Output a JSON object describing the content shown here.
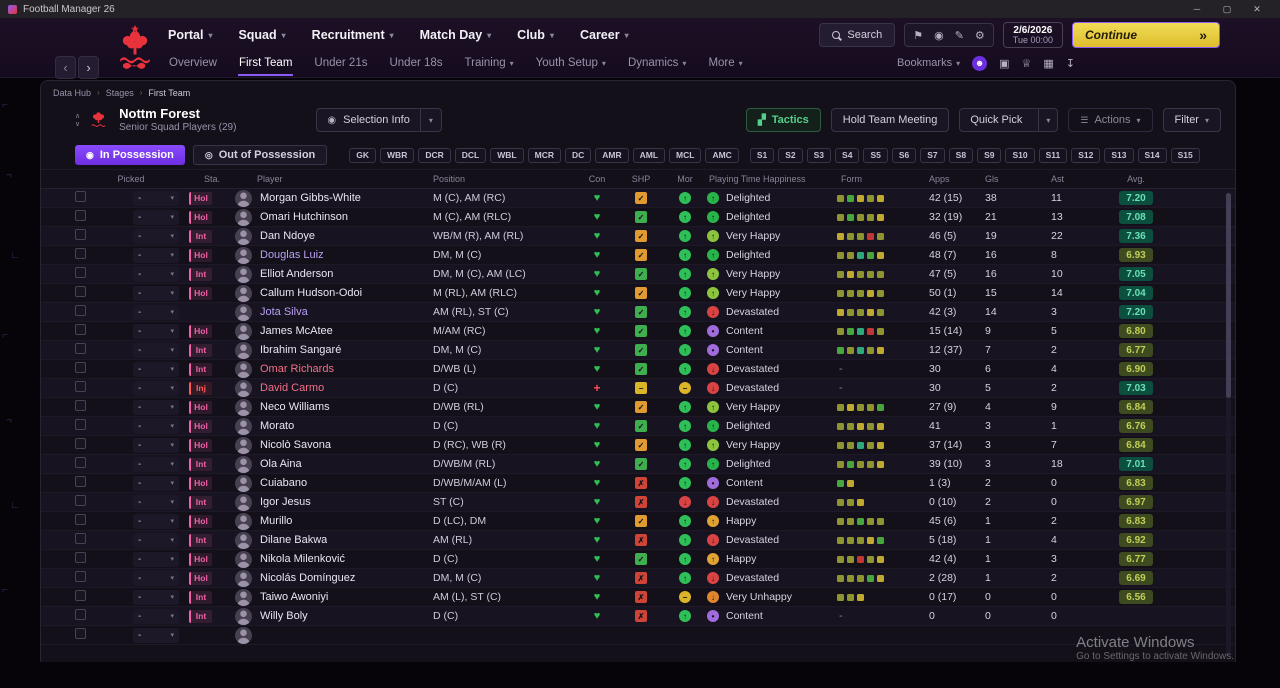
{
  "titlebar": {
    "title": "Football Manager 26",
    "controls": [
      {
        "name": "minimize-button",
        "glyph": "─"
      },
      {
        "name": "maximize-button",
        "glyph": "▢"
      },
      {
        "name": "close-button",
        "glyph": "✕"
      }
    ]
  },
  "nav": {
    "menus": [
      {
        "label": "Portal"
      },
      {
        "label": "Squad"
      },
      {
        "label": "Recruitment"
      },
      {
        "label": "Match Day"
      },
      {
        "label": "Club"
      },
      {
        "label": "Career"
      }
    ],
    "search_label": "Search",
    "icons": [
      {
        "name": "bookmark-icon",
        "glyph": "⚑"
      },
      {
        "name": "ball-icon",
        "glyph": "◉"
      },
      {
        "name": "edit-icon",
        "glyph": "✎"
      },
      {
        "name": "settings-icon",
        "glyph": "⚙"
      }
    ],
    "date": "2/6/2026",
    "time": "Tue 00:00",
    "continue_label": "Continue",
    "continue_chevron": "»"
  },
  "subnav": {
    "tabs": [
      {
        "label": "Overview",
        "caret": false
      },
      {
        "label": "First Team",
        "caret": false
      },
      {
        "label": "Under 21s",
        "caret": false
      },
      {
        "label": "Under 18s",
        "caret": false
      },
      {
        "label": "Training",
        "caret": true
      },
      {
        "label": "Youth Setup",
        "caret": true
      },
      {
        "label": "Dynamics",
        "caret": true
      },
      {
        "label": "More",
        "caret": true
      }
    ],
    "active": "First Team",
    "bookmarks_label": "Bookmarks",
    "icons": [
      {
        "name": "assistant-icon",
        "glyph": "☻",
        "accent": true
      },
      {
        "name": "squad-icon",
        "glyph": "▣",
        "accent": false
      },
      {
        "name": "awards-icon",
        "glyph": "♕",
        "accent": false
      },
      {
        "name": "calendar-icon",
        "glyph": "▦",
        "accent": false
      },
      {
        "name": "export-icon",
        "glyph": "↧",
        "accent": false
      }
    ]
  },
  "breadcrumb": [
    "Data Hub",
    "Stages",
    "First Team"
  ],
  "header": {
    "team": "Nottm Forest",
    "subtitle": "Senior Squad Players (29)",
    "selection_info": "Selection Info",
    "buttons": {
      "tactics": "Tactics",
      "meeting": "Hold Team Meeting",
      "quick_pick": "Quick Pick",
      "actions": "Actions",
      "filter": "Filter"
    }
  },
  "possession": {
    "in": "In Possession",
    "out": "Out of Possession"
  },
  "position_chips": [
    "GK",
    "WBR",
    "DCR",
    "DCL",
    "WBL",
    "MCR",
    "DC",
    "AMR",
    "AML",
    "MCL",
    "AMC",
    "S1",
    "S2",
    "S3",
    "S4",
    "S5",
    "S6",
    "S7",
    "S8",
    "S9",
    "S10",
    "S11",
    "S12",
    "S13",
    "S14",
    "S15"
  ],
  "table": {
    "columns": [
      "Picked",
      "Sta.",
      "Player",
      "Position",
      "Con",
      "SHP",
      "Mor",
      "Playing Time Happiness",
      "Form",
      "Apps",
      "Gls",
      "Ast",
      "Avg."
    ],
    "picked_value": "-",
    "rows": [
      {
        "status": "Hol",
        "name": "Morgan Gibbs-White",
        "name_color": "default",
        "position": "M (C), AM (RC)",
        "con": "green",
        "shp": "orange",
        "mor": "green",
        "happy": "Delighted",
        "form": [
          "olive",
          "green",
          "yellow",
          "olive",
          "yellow"
        ],
        "apps": "42 (15)",
        "gls": "38",
        "ast": "11",
        "avg": "7.20"
      },
      {
        "status": "Hol",
        "name": "Omari Hutchinson",
        "name_color": "default",
        "position": "M (C), AM (RLC)",
        "con": "green",
        "shp": "green",
        "mor": "green",
        "happy": "Delighted",
        "form": [
          "olive",
          "green",
          "olive",
          "olive",
          "yellow"
        ],
        "apps": "32 (19)",
        "gls": "21",
        "ast": "13",
        "avg": "7.08"
      },
      {
        "status": "Int",
        "name": "Dan Ndoye",
        "name_color": "default",
        "position": "WB/M (R), AM (RL)",
        "con": "green",
        "shp": "orange",
        "mor": "green",
        "happy": "Very Happy",
        "form": [
          "yellow",
          "olive",
          "olive",
          "red",
          "olive"
        ],
        "apps": "46 (5)",
        "gls": "19",
        "ast": "22",
        "avg": "7.36"
      },
      {
        "status": "Hol",
        "name": "Douglas Luiz",
        "name_color": "purple",
        "position": "DM, M (C)",
        "con": "green",
        "shp": "orange",
        "mor": "green",
        "happy": "Delighted",
        "form": [
          "olive",
          "olive",
          "teal",
          "green",
          "yellow"
        ],
        "apps": "48 (7)",
        "gls": "16",
        "ast": "8",
        "avg": "6.93"
      },
      {
        "status": "Int",
        "name": "Elliot Anderson",
        "name_color": "default",
        "position": "DM, M (C), AM (LC)",
        "con": "green",
        "shp": "green",
        "mor": "green",
        "happy": "Very Happy",
        "form": [
          "olive",
          "yellow",
          "olive",
          "olive",
          "olive"
        ],
        "apps": "47 (5)",
        "gls": "16",
        "ast": "10",
        "avg": "7.05"
      },
      {
        "status": "Hol",
        "name": "Callum Hudson-Odoi",
        "name_color": "default",
        "position": "M (RL), AM (RLC)",
        "con": "green",
        "shp": "orange",
        "mor": "green",
        "happy": "Very Happy",
        "form": [
          "olive",
          "olive",
          "olive",
          "yellow",
          "olive"
        ],
        "apps": "50 (1)",
        "gls": "15",
        "ast": "14",
        "avg": "7.04"
      },
      {
        "status": "",
        "name": "Jota Silva",
        "name_color": "purple",
        "position": "AM (RL), ST (C)",
        "con": "green",
        "shp": "green",
        "mor": "green",
        "happy": "Devastated",
        "form": [
          "yellow",
          "olive",
          "olive",
          "yellow",
          "olive"
        ],
        "apps": "42 (3)",
        "gls": "14",
        "ast": "3",
        "avg": "7.20"
      },
      {
        "status": "Hol",
        "name": "James McAtee",
        "name_color": "default",
        "position": "M/AM (RC)",
        "con": "green",
        "shp": "green",
        "mor": "green",
        "happy": "Content",
        "form": [
          "olive",
          "green",
          "teal",
          "red",
          "olive"
        ],
        "apps": "15 (14)",
        "gls": "9",
        "ast": "5",
        "avg": "6.80"
      },
      {
        "status": "Int",
        "name": "Ibrahim Sangaré",
        "name_color": "default",
        "position": "DM, M (C)",
        "con": "green",
        "shp": "green",
        "mor": "green",
        "happy": "Content",
        "form": [
          "green",
          "olive",
          "teal",
          "olive",
          "yellow"
        ],
        "apps": "12 (37)",
        "gls": "7",
        "ast": "2",
        "avg": "6.77"
      },
      {
        "status": "Int",
        "name": "Omar Richards",
        "name_color": "red",
        "position": "D/WB (L)",
        "con": "green",
        "shp": "green",
        "mor": "green",
        "happy": "Devastated",
        "form": [],
        "apps": "30",
        "gls": "6",
        "ast": "4",
        "avg": "6.90"
      },
      {
        "status": "Inj",
        "name": "David Carmo",
        "name_color": "red",
        "position": "D (C)",
        "con": "red",
        "shp": "yellow",
        "mor": "yellow",
        "happy": "Devastated",
        "form": [],
        "apps": "30",
        "gls": "5",
        "ast": "2",
        "avg": "7.03"
      },
      {
        "status": "Hol",
        "name": "Neco Williams",
        "name_color": "default",
        "position": "D/WB (RL)",
        "con": "green",
        "shp": "orange",
        "mor": "green",
        "happy": "Very Happy",
        "form": [
          "olive",
          "yellow",
          "olive",
          "olive",
          "green"
        ],
        "apps": "27 (9)",
        "gls": "4",
        "ast": "9",
        "avg": "6.84"
      },
      {
        "status": "Hol",
        "name": "Morato",
        "name_color": "default",
        "position": "D (C)",
        "con": "green",
        "shp": "green",
        "mor": "green",
        "happy": "Delighted",
        "form": [
          "olive",
          "olive",
          "yellow",
          "olive",
          "yellow"
        ],
        "apps": "41",
        "gls": "3",
        "ast": "1",
        "avg": "6.76"
      },
      {
        "status": "Hol",
        "name": "Nicolò Savona",
        "name_color": "default",
        "position": "D (RC), WB (R)",
        "con": "green",
        "shp": "orange",
        "mor": "green",
        "happy": "Very Happy",
        "form": [
          "olive",
          "olive",
          "teal",
          "olive",
          "yellow"
        ],
        "apps": "37 (14)",
        "gls": "3",
        "ast": "7",
        "avg": "6.84"
      },
      {
        "status": "Int",
        "name": "Ola Aina",
        "name_color": "default",
        "position": "D/WB/M (RL)",
        "con": "green",
        "shp": "green",
        "mor": "green",
        "happy": "Delighted",
        "form": [
          "olive",
          "green",
          "olive",
          "olive",
          "yellow"
        ],
        "apps": "39 (10)",
        "gls": "3",
        "ast": "18",
        "avg": "7.01"
      },
      {
        "status": "Hol",
        "name": "Cuiabano",
        "name_color": "default",
        "position": "D/WB/M/AM (L)",
        "con": "green",
        "shp": "red",
        "mor": "green",
        "happy": "Content",
        "form": [
          "green",
          "yellow"
        ],
        "apps": "1 (3)",
        "gls": "2",
        "ast": "0",
        "avg": "6.83"
      },
      {
        "status": "Int",
        "name": "Igor Jesus",
        "name_color": "default",
        "position": "ST (C)",
        "con": "green",
        "shp": "red",
        "mor": "red",
        "happy": "Devastated",
        "form": [
          "olive",
          "olive",
          "yellow"
        ],
        "apps": "0 (10)",
        "gls": "2",
        "ast": "0",
        "avg": "6.97"
      },
      {
        "status": "Hol",
        "name": "Murillo",
        "name_color": "default",
        "position": "D (LC), DM",
        "con": "green",
        "shp": "orange",
        "mor": "green",
        "happy": "Happy",
        "form": [
          "olive",
          "olive",
          "green",
          "olive",
          "olive"
        ],
        "apps": "45 (6)",
        "gls": "1",
        "ast": "2",
        "avg": "6.83"
      },
      {
        "status": "Int",
        "name": "Dilane Bakwa",
        "name_color": "default",
        "position": "AM (RL)",
        "con": "green",
        "shp": "red",
        "mor": "green",
        "happy": "Devastated",
        "form": [
          "olive",
          "olive",
          "olive",
          "yellow",
          "green"
        ],
        "apps": "5 (18)",
        "gls": "1",
        "ast": "4",
        "avg": "6.92"
      },
      {
        "status": "Hol",
        "name": "Nikola Milenković",
        "name_color": "default",
        "position": "D (C)",
        "con": "green",
        "shp": "green",
        "mor": "green",
        "happy": "Happy",
        "form": [
          "olive",
          "olive",
          "red",
          "olive",
          "yellow"
        ],
        "apps": "42 (4)",
        "gls": "1",
        "ast": "3",
        "avg": "6.77"
      },
      {
        "status": "Hol",
        "name": "Nicolás Domínguez",
        "name_color": "default",
        "position": "DM, M (C)",
        "con": "green",
        "shp": "red",
        "mor": "green",
        "happy": "Devastated",
        "form": [
          "olive",
          "olive",
          "olive",
          "green",
          "yellow"
        ],
        "apps": "2 (28)",
        "gls": "1",
        "ast": "2",
        "avg": "6.69"
      },
      {
        "status": "Int",
        "name": "Taiwo Awoniyi",
        "name_color": "default",
        "position": "AM (L), ST (C)",
        "con": "green",
        "shp": "red",
        "mor": "yellow",
        "happy": "Very Unhappy",
        "form": [
          "olive",
          "olive",
          "yellow"
        ],
        "apps": "0 (17)",
        "gls": "0",
        "ast": "0",
        "avg": "6.56"
      },
      {
        "status": "Int",
        "name": "Willy Boly",
        "name_color": "default",
        "position": "D (C)",
        "con": "green",
        "shp": "red",
        "mor": "green",
        "happy": "Content",
        "form": [],
        "apps": "0",
        "gls": "0",
        "ast": "0",
        "avg": ""
      },
      {
        "partial": true,
        "status": "",
        "name": "",
        "name_color": "default",
        "position": "",
        "con": "",
        "shp": "",
        "mor": "",
        "happy": "",
        "form": [],
        "apps": "",
        "gls": "",
        "ast": "",
        "avg": ""
      }
    ]
  },
  "colors": {
    "accent": "#7d3cf5",
    "continue": "#e9ce44",
    "crest_red": "#e8333d",
    "form": {
      "olive": "#8e9430",
      "yellow": "#bfa92e",
      "green": "#48a73c",
      "teal": "#2fa97c",
      "red": "#c23636"
    },
    "happy": {
      "Delighted": "#28b44a",
      "Very Happy": "#8cc43f",
      "Happy": "#dfa233",
      "Content": "#a06bdb",
      "Devastated": "#d84343",
      "Very Unhappy": "#e0862c"
    },
    "mor": {
      "green": "#2fbf57",
      "yellow": "#d9b527",
      "red": "#d84343"
    },
    "shp": {
      "green": "#3fae4e",
      "orange": "#e09a2f",
      "red": "#cf4436",
      "yellow": "#d9b527"
    },
    "con": {
      "green": "#2fbf57",
      "red": "#ff5050"
    },
    "status": {
      "Hol": "#f061a8",
      "Int": "#f061a8",
      "Inj": "#ff5a5a"
    }
  },
  "watermark": {
    "line1": "Activate Windows",
    "line2": "Go to Settings to activate Windows."
  },
  "decor_glyphs": [
    "⌐",
    "¬",
    "∟",
    "⌐",
    "¬",
    "∟",
    "⌐"
  ]
}
